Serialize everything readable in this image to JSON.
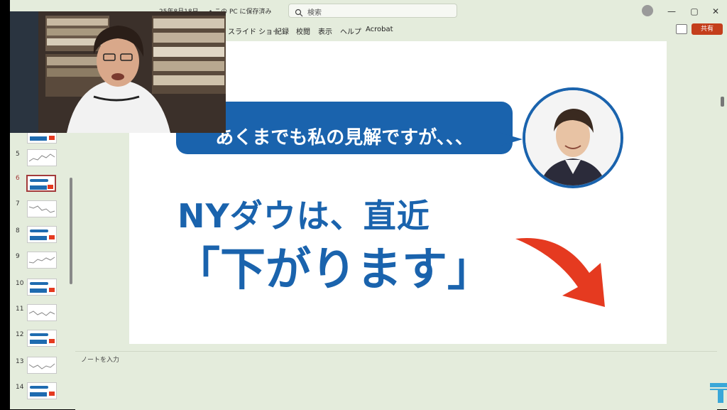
{
  "titlebar": {
    "title": "25年8月18日 ... • この PC に保存済み",
    "search_placeholder": "検索",
    "window_controls": [
      "—",
      "▢",
      "✕"
    ]
  },
  "ribbon": {
    "menu": [
      "スライド ショー",
      "記録",
      "校閲",
      "表示",
      "ヘルプ",
      "Acrobat"
    ],
    "share_label": "共有"
  },
  "thumbnails": {
    "numbers": [
      "5",
      "6",
      "7",
      "8",
      "9",
      "10",
      "11",
      "12",
      "13",
      "14"
    ],
    "selected": "6"
  },
  "slide": {
    "bubble_text": "あくまでも私の見解ですが、、、",
    "headline": "NYダウは、直近",
    "headline_emphasis": "「下がります」",
    "accent_color": "#1a63ad",
    "arrow_color": "#e53a20"
  },
  "notes": {
    "placeholder": "ノートを入力"
  },
  "icons": [
    "search-icon",
    "user-icon",
    "comment-icon",
    "arrow-down-right-icon",
    "logo-t-icon"
  ]
}
